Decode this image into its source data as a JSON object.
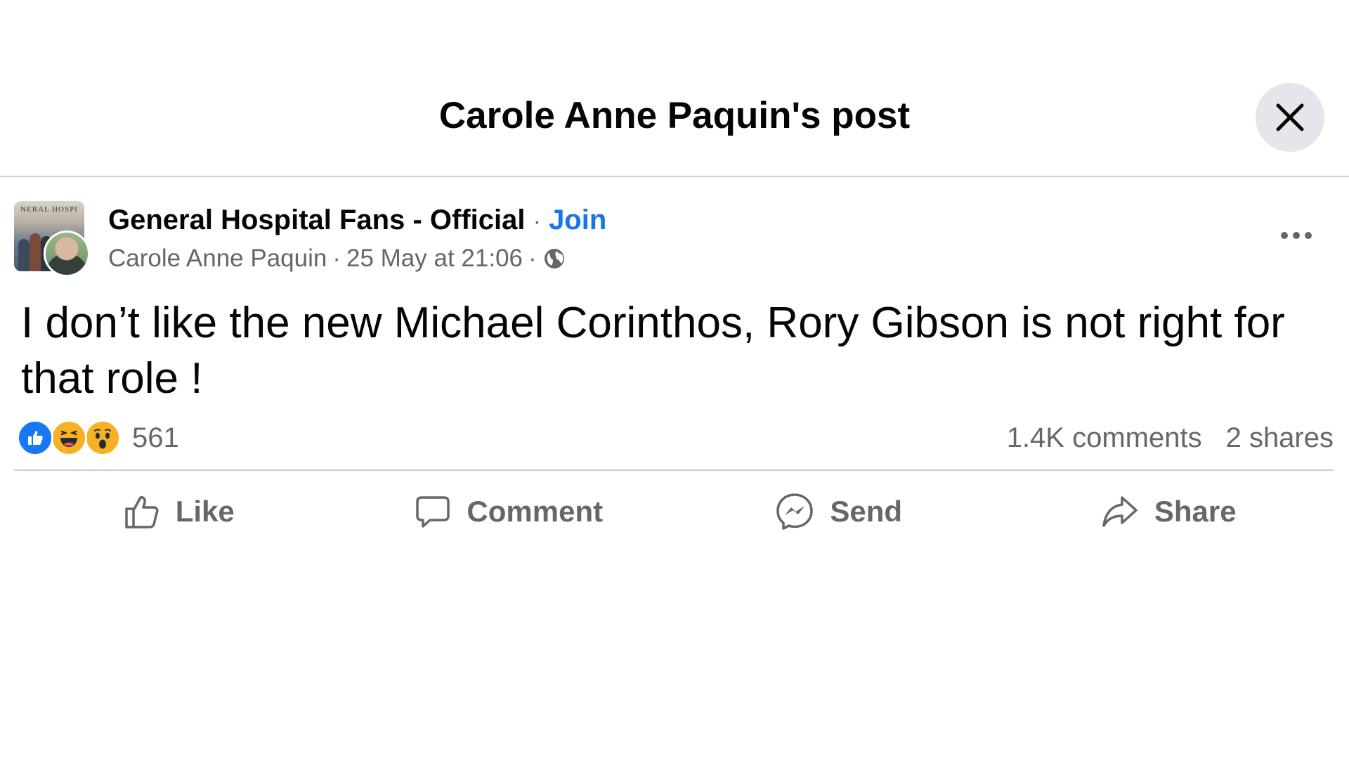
{
  "header": {
    "title": "Carole Anne Paquin's post"
  },
  "post": {
    "group_name": "General Hospital Fans - Official",
    "separator": "·",
    "join_label": "Join",
    "author": "Carole Anne Paquin",
    "timestamp": "25 May at 21:06",
    "audience_icon": "globe-icon",
    "group_avatar_banner": "NERAL HOSPI",
    "text": "I don’t like the new Michael Corinthos, Rory Gibson is not right for that role !",
    "reactions": {
      "types": [
        "like",
        "haha",
        "wow"
      ],
      "count": "561"
    },
    "comments_count": "1.4K comments",
    "shares_count": "2 shares"
  },
  "actions": {
    "like_label": "Like",
    "comment_label": "Comment",
    "send_label": "Send",
    "share_label": "Share"
  },
  "colors": {
    "link_blue": "#1b74e4",
    "secondary_text": "#65676b",
    "close_bg": "#e4e6eb",
    "divider": "#ced0d4"
  }
}
